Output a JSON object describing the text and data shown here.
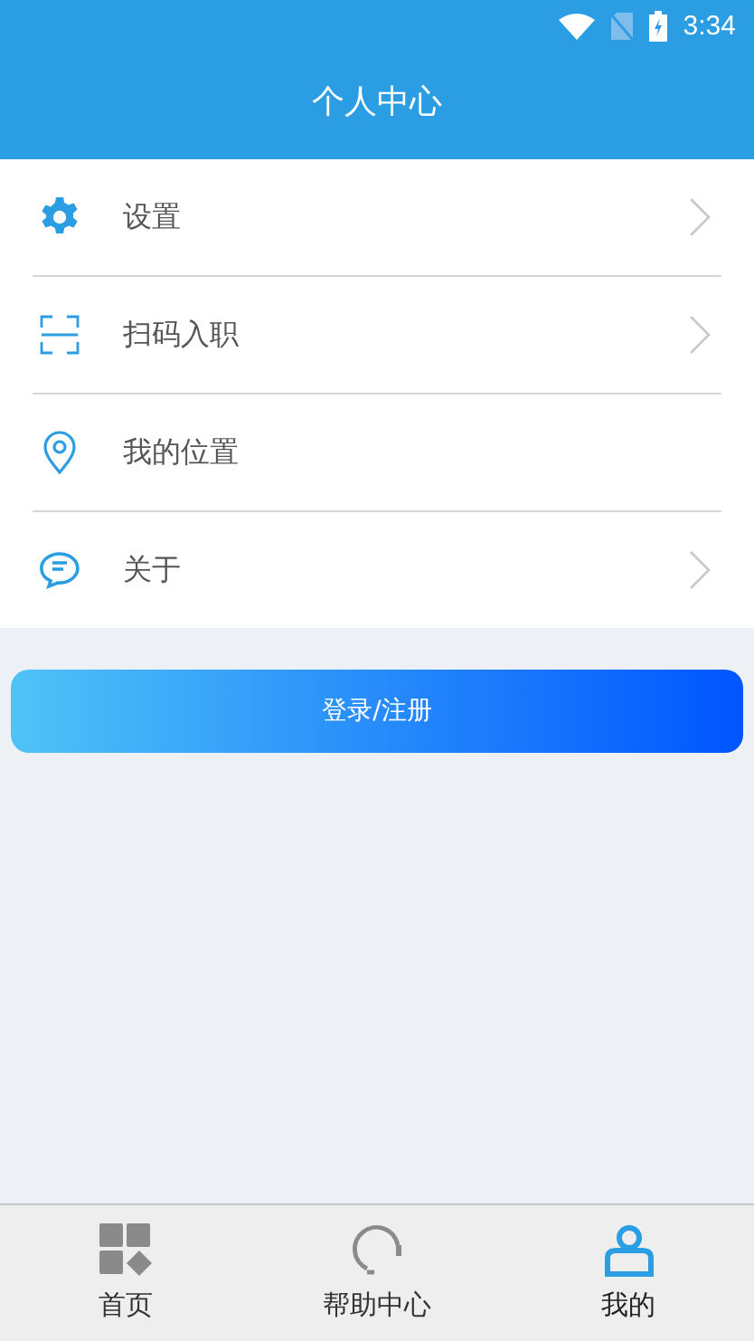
{
  "status_bar": {
    "time": "3:34"
  },
  "header": {
    "title": "个人中心"
  },
  "menu": [
    {
      "kind": "gear",
      "label": "设置",
      "chevron": true
    },
    {
      "kind": "scan",
      "label": "扫码入职",
      "chevron": true
    },
    {
      "kind": "pin",
      "label": "我的位置",
      "chevron": false
    },
    {
      "kind": "chat",
      "label": "关于",
      "chevron": true
    }
  ],
  "login_button": {
    "label": "登录/注册"
  },
  "tab_bar": [
    {
      "kind": "home",
      "label": "首页",
      "selected": false
    },
    {
      "kind": "headset",
      "label": "帮助中心",
      "selected": false
    },
    {
      "kind": "user",
      "label": "我的",
      "selected": true
    }
  ]
}
